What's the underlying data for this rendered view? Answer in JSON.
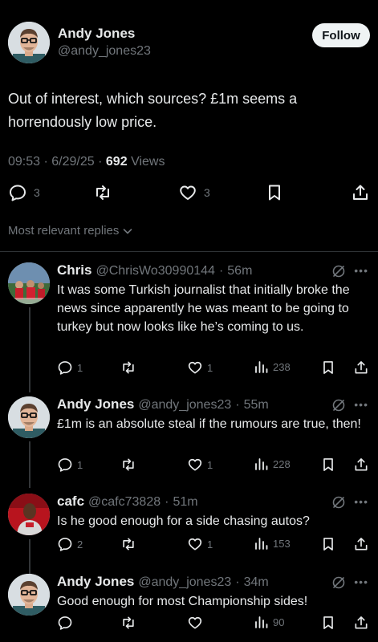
{
  "main_tweet": {
    "author_name": "Andy Jones",
    "handle": "@andy_jones23",
    "follow_label": "Follow",
    "text": "Out of interest, which sources? £1m seems a horrendously low price.",
    "time": "09:53",
    "date": "6/29/25",
    "views_count": "692",
    "views_label": "Views",
    "replies": "3",
    "likes": "3"
  },
  "replies_filter": {
    "label": "Most relevant replies"
  },
  "replies": [
    {
      "name": "Chris",
      "handle": "@ChrisWo30990144",
      "time": "56m",
      "text": "It was some Turkish journalist that initially broke the news since apparently he was meant to be going to turkey but now looks like he’s coming to us.",
      "replies": "1",
      "retweets": "",
      "likes": "1",
      "views": "238"
    },
    {
      "name": "Andy Jones",
      "handle": "@andy_jones23",
      "time": "55m",
      "text": "£1m is an absolute steal if the rumours are true, then!",
      "replies": "1",
      "retweets": "",
      "likes": "1",
      "views": "228"
    },
    {
      "name": "cafc",
      "handle": "@cafc73828",
      "time": "51m",
      "text": "Is he good enough for a side chasing autos?",
      "replies": "2",
      "retweets": "",
      "likes": "1",
      "views": "153"
    },
    {
      "name": "Andy Jones",
      "handle": "@andy_jones23",
      "time": "34m",
      "text": "Good enough for most Championship sides!",
      "replies": "",
      "retweets": "",
      "likes": "",
      "views": "90"
    }
  ],
  "icons": [
    "reply-icon",
    "retweet-icon",
    "like-icon",
    "bookmark-icon",
    "share-icon",
    "views-icon",
    "grok-icon",
    "more-icon",
    "chevron-down-icon"
  ],
  "colors": {
    "background": "#000000",
    "text": "#e7e9ea",
    "secondary": "#71767b",
    "divider": "#2f3336"
  }
}
